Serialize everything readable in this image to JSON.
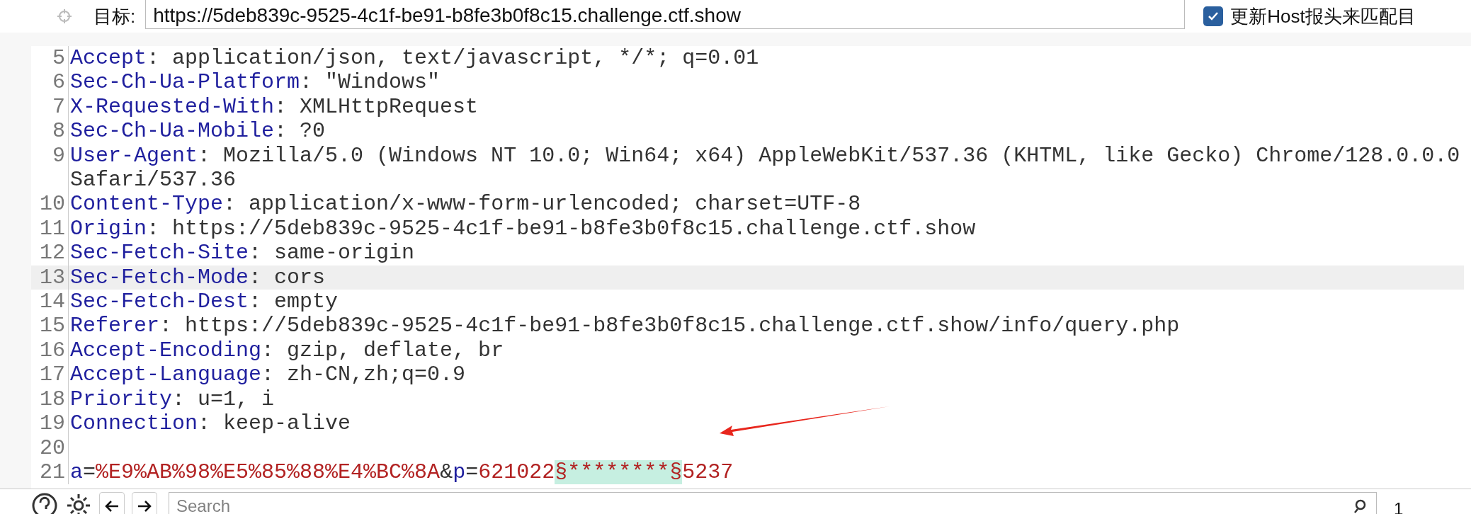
{
  "target": {
    "label": "目标:",
    "url": "https://5deb839c-9525-4c1f-be91-b8fe3b0f8c15.challenge.ctf.show"
  },
  "update_host": {
    "label": "更新Host报头来匹配目",
    "checked": true
  },
  "lines": [
    {
      "number": "5",
      "kind": "header",
      "name": "Accept",
      "sep": ":",
      "value": "application/json, text/javascript, */*; q=0.01",
      "highlighted": false
    },
    {
      "number": "6",
      "kind": "header",
      "name": "Sec-Ch-Ua-Platform",
      "sep": ":",
      "value": "\"Windows\"",
      "highlighted": false
    },
    {
      "number": "7",
      "kind": "header",
      "name": "X-Requested-With",
      "sep": ":",
      "value": "XMLHttpRequest",
      "highlighted": false
    },
    {
      "number": "8",
      "kind": "header",
      "name": "Sec-Ch-Ua-Mobile",
      "sep": ":",
      "value": "?0",
      "highlighted": false
    },
    {
      "number": "9",
      "kind": "header",
      "name": "User-Agent",
      "sep": ":",
      "value": "Mozilla/5.0 (Windows NT 10.0; Win64; x64) AppleWebKit/537.36 (KHTML, like Gecko) Chrome/128.0.0.0 Safari/537.36",
      "highlighted": false
    },
    {
      "number": "10",
      "kind": "header",
      "name": "Content-Type",
      "sep": ":",
      "value": "application/x-www-form-urlencoded; charset=UTF-8",
      "highlighted": false
    },
    {
      "number": "11",
      "kind": "header",
      "name": "Origin",
      "sep": ":",
      "value": "https://5deb839c-9525-4c1f-be91-b8fe3b0f8c15.challenge.ctf.show",
      "highlighted": false
    },
    {
      "number": "12",
      "kind": "header",
      "name": "Sec-Fetch-Site",
      "sep": ":",
      "value": "same-origin",
      "highlighted": false
    },
    {
      "number": "13",
      "kind": "header",
      "name": "Sec-Fetch-Mode",
      "sep": ":",
      "value": "cors",
      "highlighted": true
    },
    {
      "number": "14",
      "kind": "header",
      "name": "Sec-Fetch-Dest",
      "sep": ":",
      "value": "empty",
      "highlighted": false
    },
    {
      "number": "15",
      "kind": "header",
      "name": "Referer",
      "sep": ":",
      "value": "https://5deb839c-9525-4c1f-be91-b8fe3b0f8c15.challenge.ctf.show/info/query.php",
      "highlighted": false
    },
    {
      "number": "16",
      "kind": "header",
      "name": "Accept-Encoding",
      "sep": ":",
      "value": "gzip, deflate, br",
      "highlighted": false
    },
    {
      "number": "17",
      "kind": "header",
      "name": "Accept-Language",
      "sep": ":",
      "value": "zh-CN,zh;q=0.9",
      "highlighted": false
    },
    {
      "number": "18",
      "kind": "header",
      "name": "Priority",
      "sep": ":",
      "value": "u=1, i",
      "highlighted": false
    },
    {
      "number": "19",
      "kind": "header",
      "name": "Connection",
      "sep": ":",
      "value": "keep-alive",
      "highlighted": false
    },
    {
      "number": "20",
      "kind": "blank",
      "highlighted": false
    },
    {
      "number": "21",
      "kind": "body",
      "highlighted": false,
      "segments": [
        {
          "kind": "param",
          "text": "a"
        },
        {
          "kind": "sep",
          "text": "="
        },
        {
          "kind": "value",
          "text": "%E9%AB%98%E5%85%88%E4%BC%8A"
        },
        {
          "kind": "sep",
          "text": "&"
        },
        {
          "kind": "param",
          "text": "p"
        },
        {
          "kind": "sep",
          "text": "="
        },
        {
          "kind": "value",
          "text": "621022"
        },
        {
          "kind": "marker",
          "text": "§********§"
        },
        {
          "kind": "value",
          "text": "5237"
        }
      ]
    }
  ],
  "search": {
    "placeholder": "Search"
  },
  "match_count": "1"
}
